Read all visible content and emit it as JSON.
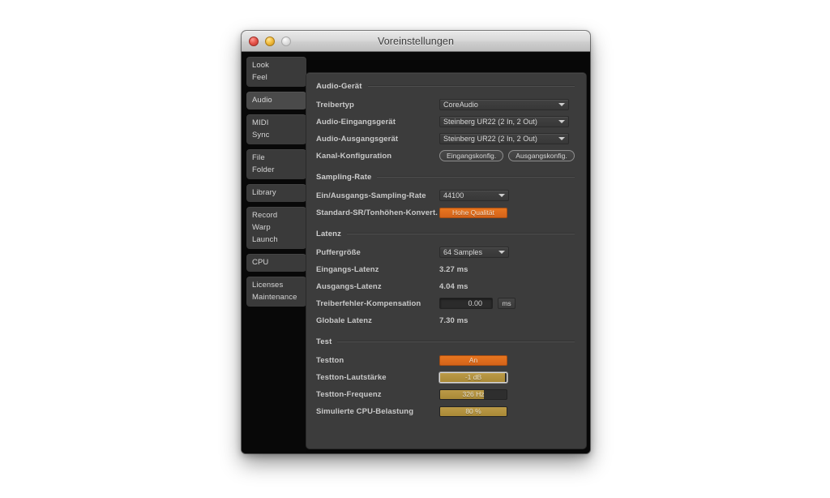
{
  "window": {
    "title": "Voreinstellungen",
    "traffic_lights": [
      "close-button",
      "minimize-button",
      "zoom-button"
    ]
  },
  "sidebar": {
    "groups": [
      {
        "id": "look-feel",
        "selected": false,
        "lines": [
          "Look",
          "Feel"
        ]
      },
      {
        "id": "audio",
        "selected": true,
        "lines": [
          "Audio"
        ]
      },
      {
        "id": "midi-sync",
        "selected": false,
        "lines": [
          "MIDI",
          "Sync"
        ]
      },
      {
        "id": "file-folder",
        "selected": false,
        "lines": [
          "File",
          "Folder"
        ]
      },
      {
        "id": "library",
        "selected": false,
        "lines": [
          "Library"
        ]
      },
      {
        "id": "record-warp-launch",
        "selected": false,
        "lines": [
          "Record",
          "Warp",
          "Launch"
        ]
      },
      {
        "id": "cpu",
        "selected": false,
        "lines": [
          "CPU"
        ]
      },
      {
        "id": "licenses-maintenance",
        "selected": false,
        "lines": [
          "Licenses",
          "Maintenance"
        ]
      }
    ]
  },
  "sections": {
    "audio_device": {
      "title": "Audio-Gerät",
      "driver_type": {
        "label": "Treibertyp",
        "value": "CoreAudio"
      },
      "input_device": {
        "label": "Audio-Eingangsgerät",
        "value": "Steinberg UR22 (2 In, 2 Out)"
      },
      "output_device": {
        "label": "Audio-Ausgangsgerät",
        "value": "Steinberg UR22 (2 In, 2 Out)"
      },
      "channel_config": {
        "label": "Kanal-Konfiguration",
        "input_button": "Eingangskonfig.",
        "output_button": "Ausgangskonfig."
      }
    },
    "sampling_rate": {
      "title": "Sampling-Rate",
      "io_sample_rate": {
        "label": "Ein/Ausgangs-Sampling-Rate",
        "value": "44100"
      },
      "sr_conversion": {
        "label": "Standard-SR/Tonhöhen-Konvert.",
        "value": "Hohe Qualität"
      }
    },
    "latency": {
      "title": "Latenz",
      "buffer_size": {
        "label": "Puffergröße",
        "value": "64 Samples"
      },
      "input_latency": {
        "label": "Eingangs-Latenz",
        "value": "3.27 ms"
      },
      "output_latency": {
        "label": "Ausgangs-Latenz",
        "value": "4.04 ms"
      },
      "driver_error_comp": {
        "label": "Treiberfehler-Kompensation",
        "value": "0.00",
        "unit": "ms"
      },
      "overall_latency": {
        "label": "Globale Latenz",
        "value": "7.30 ms"
      }
    },
    "test": {
      "title": "Test",
      "test_tone": {
        "label": "Testton",
        "value": "An"
      },
      "test_tone_volume": {
        "label": "Testton-Lautstärke",
        "value": "-1 dB",
        "fill_percent": 97
      },
      "test_tone_frequency": {
        "label": "Testton-Frequenz",
        "value": "326 Hz",
        "fill_percent": 66
      },
      "cpu_load_simulator": {
        "label": "Simulierte CPU-Belastung",
        "value": "80 %",
        "fill_percent": 100
      }
    }
  }
}
